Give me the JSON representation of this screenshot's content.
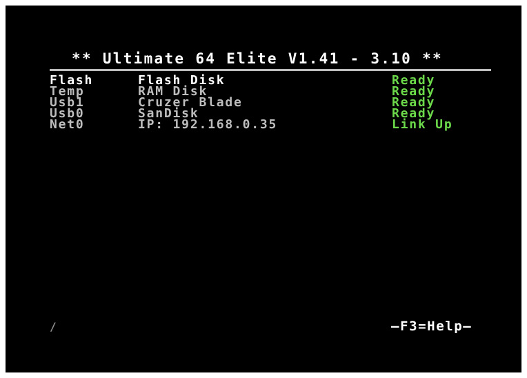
{
  "title": "** Ultimate 64 Elite V1.41 - 3.10 **",
  "devices": [
    {
      "name": "Flash",
      "description": "Flash Disk",
      "status": "Ready"
    },
    {
      "name": "Temp",
      "description": "RAM Disk",
      "status": "Ready"
    },
    {
      "name": "Usb1",
      "description": "Cruzer Blade",
      "status": "Ready"
    },
    {
      "name": "Usb0",
      "description": "SanDisk",
      "status": "Ready"
    },
    {
      "name": "Net0",
      "description": "IP: 192.168.0.35",
      "status": "Link Up"
    }
  ],
  "footer": {
    "cursor_glyph": "/",
    "help_label": "—F3=Help—"
  },
  "colors": {
    "background": "#000000",
    "text_selected": "#ffffff",
    "text_normal": "#bdbdbd",
    "status": "#6cd94b"
  }
}
